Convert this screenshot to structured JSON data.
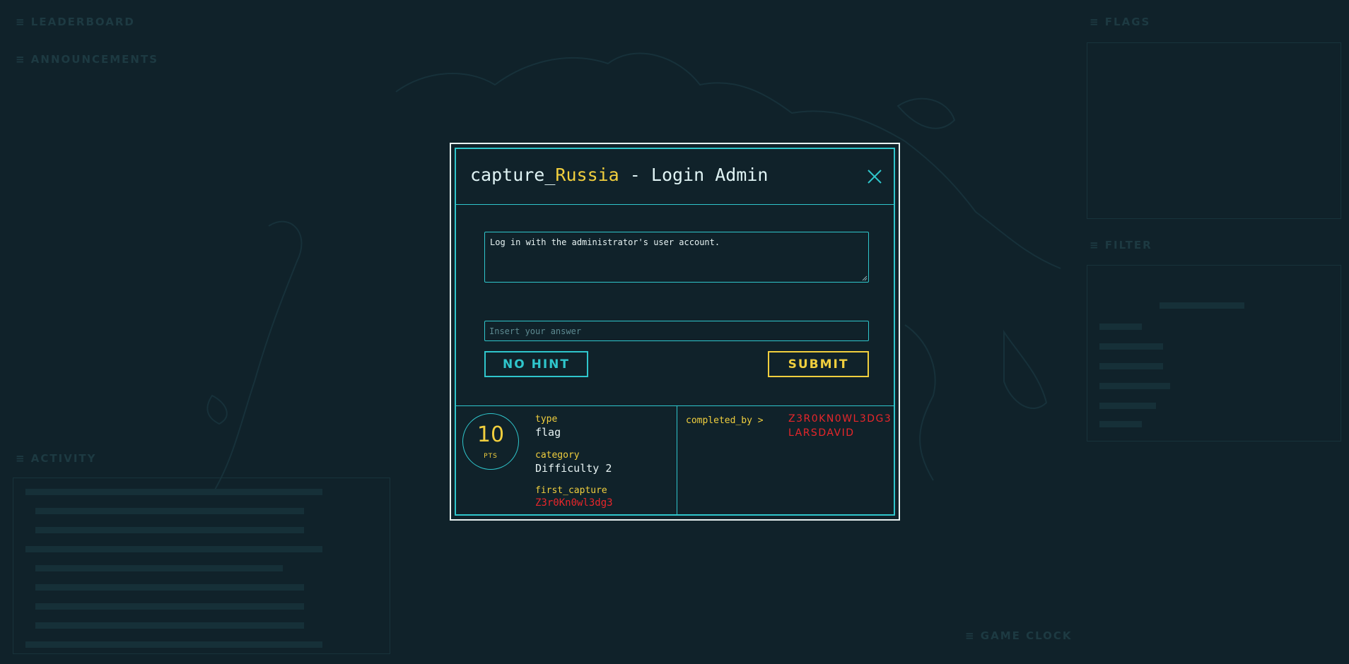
{
  "background": {
    "panels": [
      {
        "name": "leaderboard",
        "label": "≡ LEADERBOARD"
      },
      {
        "name": "announcements",
        "label": "≡ ANNOUNCEMENTS"
      },
      {
        "name": "flags",
        "label": "≡ FLAGS"
      },
      {
        "name": "filter",
        "label": "≡ FILTER"
      },
      {
        "name": "activity",
        "label": "≡ ACTIVITY"
      },
      {
        "name": "game-clock",
        "label": "≡ GAME CLOCK"
      }
    ]
  },
  "modal": {
    "title_prefix": "capture_",
    "title_country": "Russia",
    "title_suffix": " - Login Admin",
    "description": "Log in with the administrator's user account.",
    "answer_placeholder": "Insert your answer",
    "hint_button": "NO HINT",
    "submit_button": "SUBMIT",
    "points": "10",
    "points_label": "PTS",
    "type_label": "type",
    "type_value": "flag",
    "category_label": "category",
    "category_value": "Difficulty 2",
    "first_capture_label": "first_capture",
    "first_capture_value": "Z3r0Kn0wl3dg3",
    "completed_by_label": "completed_by >",
    "completed_by": [
      "Z3R0KN0WL3DG3",
      "LARSDAVID"
    ]
  },
  "colors": {
    "background": "#10222a",
    "accent_cyan": "#2fc6cc",
    "accent_yellow": "#f1cf3e",
    "accent_red": "#e8262a"
  }
}
